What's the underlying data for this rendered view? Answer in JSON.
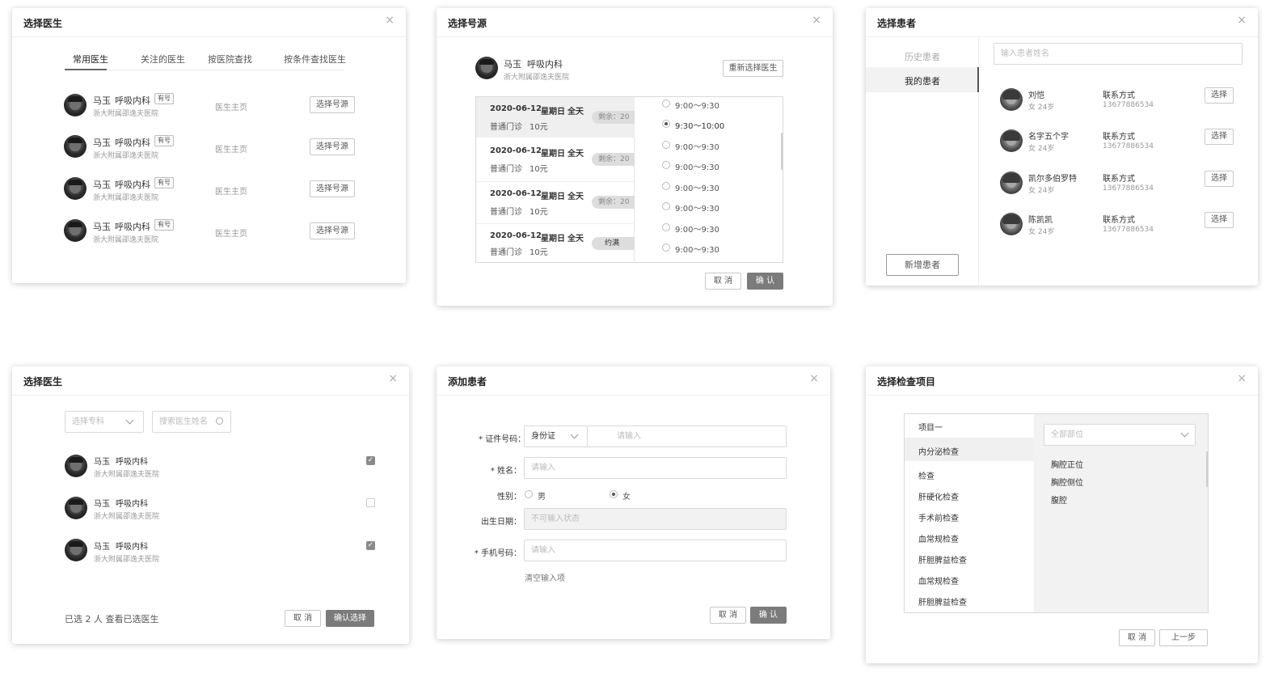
{
  "d1": {
    "title": "选择医生",
    "tabs": [
      "常用医生",
      "关注的医生",
      "按医院查找",
      "按条件查找医生"
    ],
    "rows": [
      {
        "name": "马玉",
        "dept": "呼吸内科",
        "tag": "有号",
        "hospital": "浙大附属邵逸夫医院",
        "link": "医生主页",
        "action": "选择号源"
      },
      {
        "name": "马玉",
        "dept": "呼吸内科",
        "tag": "有号",
        "hospital": "浙大附属邵逸夫医院",
        "link": "医生主页",
        "action": "选择号源"
      },
      {
        "name": "马玉",
        "dept": "呼吸内科",
        "tag": "有号",
        "hospital": "浙大附属邵逸夫医院",
        "link": "医生主页",
        "action": "选择号源"
      },
      {
        "name": "马玉",
        "dept": "呼吸内科",
        "tag": "有号",
        "hospital": "浙大附属邵逸夫医院",
        "link": "医生主页",
        "action": "选择号源"
      }
    ]
  },
  "d2": {
    "title": "选择号源",
    "doctor": {
      "name": "马玉",
      "dept": "呼吸内科",
      "hospital": "浙大附属邵逸夫医院"
    },
    "reselect": "重新选择医生",
    "schedules": [
      {
        "date": "2020-06-12",
        "weekday": "星期日",
        "period": "全天",
        "type": "普通门诊",
        "fee": "10元",
        "status": "剩余：20"
      },
      {
        "date": "2020-06-12",
        "weekday": "星期日",
        "period": "全天",
        "type": "普通门诊",
        "fee": "10元",
        "status": "剩余：20"
      },
      {
        "date": "2020-06-12",
        "weekday": "星期日",
        "period": "全天",
        "type": "普通门诊",
        "fee": "10元",
        "status": "剩余：20"
      },
      {
        "date": "2020-06-12",
        "weekday": "星期日",
        "period": "全天",
        "type": "普通门诊",
        "fee": "10元",
        "status": "约满"
      }
    ],
    "slots": [
      "9:00～9:30",
      "9:30～10:00",
      "9:00～9:30",
      "9:00～9:30",
      "9:00～9:30",
      "9:00～9:30",
      "9:00～9:30",
      "9:00～9:30"
    ],
    "selected_slot": 1,
    "cancel": "取 消",
    "confirm": "确 认"
  },
  "d3": {
    "title": "选择患者",
    "side_tabs": [
      "历史患者",
      "我的患者"
    ],
    "search_placeholder": "输入患者姓名",
    "contact_label": "联系方式",
    "patients": [
      {
        "name": "刘恺",
        "info": "女 24岁",
        "phone": "13677886534",
        "action": "选择"
      },
      {
        "name": "名字五个字",
        "info": "女 24岁",
        "phone": "13677886534",
        "action": "选择"
      },
      {
        "name": "凯尔多伯罗特",
        "info": "女 24岁",
        "phone": "13677886534",
        "action": "选择"
      },
      {
        "name": "陈凯凯",
        "info": "女 24岁",
        "phone": "13677886534",
        "action": "选择"
      }
    ],
    "add_patient": "新增患者"
  },
  "d4": {
    "title": "选择医生",
    "dept_placeholder": "选择专科",
    "search_placeholder": "搜索医生姓名",
    "rows": [
      {
        "name": "马玉",
        "dept": "呼吸内科",
        "hospital": "浙大附属邵逸夫医院",
        "checked": true
      },
      {
        "name": "马玉",
        "dept": "呼吸内科",
        "hospital": "浙大附属邵逸夫医院",
        "checked": false
      },
      {
        "name": "马玉",
        "dept": "呼吸内科",
        "hospital": "浙大附属邵逸夫医院",
        "checked": true
      }
    ],
    "summary": "已选 2 人 查看已选医生",
    "cancel": "取 消",
    "confirm": "确认选择"
  },
  "d5": {
    "title": "添加患者",
    "id_label": "证件号码：",
    "id_type": "身份证",
    "id_placeholder": "请输入",
    "name_label": "姓名：",
    "name_placeholder": "请输入",
    "gender_label": "性别：",
    "gender_male": "男",
    "gender_female": "女",
    "birth_label": "出生日期：",
    "birth_placeholder": "不可输入状态",
    "phone_label": "手机号码：",
    "phone_placeholder": "请输入",
    "clear": "清空输入项",
    "cancel": "取 消",
    "confirm": "确 认"
  },
  "d6": {
    "title": "选择检查项目",
    "items": [
      "项目一",
      "内分泌检查",
      "检查",
      "肝硬化检查",
      "手术前检查",
      "血常规检查",
      "肝胆脾益检查",
      "血常规检查",
      "肝胆脾益检查"
    ],
    "selected_item": 1,
    "site_placeholder": "全部部位",
    "sites": [
      "胸腔正位",
      "胸腔侧位",
      "腹腔"
    ],
    "cancel": "取 消",
    "prev": "上一步"
  }
}
